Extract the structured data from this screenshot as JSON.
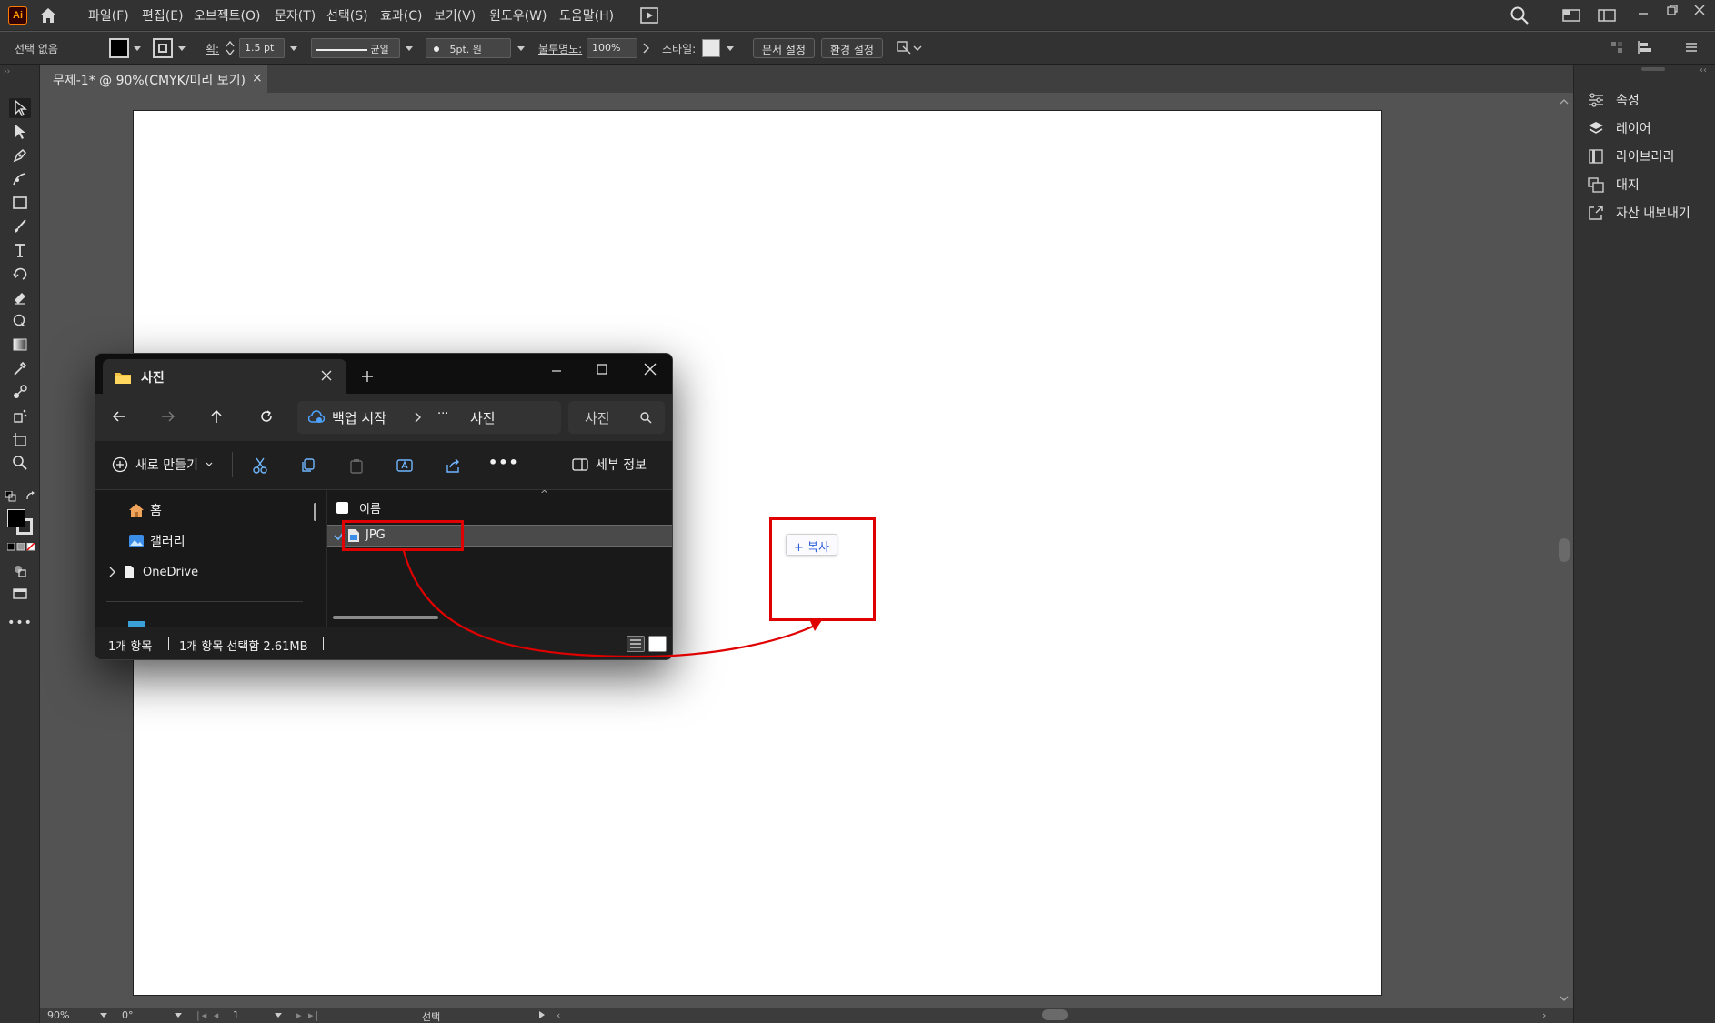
{
  "menubar": {
    "logo": "Ai",
    "items": [
      "파일(F)",
      "편집(E)",
      "오브젝트(O)",
      "문자(T)",
      "선택(S)",
      "효과(C)",
      "보기(V)",
      "윈도우(W)",
      "도움말(H)"
    ]
  },
  "controlbar": {
    "selection": "선택 없음",
    "stroke_label": "획:",
    "stroke_value": "1.5 pt",
    "profile": "균일",
    "brush": "5pt. 원",
    "opacity_label": "불투명도:",
    "opacity_value": "100%",
    "style_label": "스타일:",
    "doc_setup": "문서 설정",
    "prefs": "환경 설정"
  },
  "document_tab": {
    "title": "무제-1* @ 90%(CMYK/미리 보기)",
    "close": "×"
  },
  "right_panel": {
    "items": [
      {
        "label": "속성",
        "icon": "properties-icon"
      },
      {
        "label": "레이어",
        "icon": "layers-icon"
      },
      {
        "label": "라이브러리",
        "icon": "libraries-icon"
      },
      {
        "label": "대지",
        "icon": "artboards-icon"
      },
      {
        "label": "자산 내보내기",
        "icon": "asset-export-icon"
      }
    ]
  },
  "statusbar": {
    "zoom": "90%",
    "rotation": "0°",
    "artboard_number": "1",
    "tool_name": "선택"
  },
  "explorer": {
    "tab_title": "사진",
    "breadcrumb_root": "백업 시작",
    "breadcrumb_ellipsis": "···",
    "breadcrumb_current": "사진",
    "search_placeholder": "사진",
    "new_button": "새로 만들기",
    "details_button": "세부 정보",
    "sidebar": [
      "홈",
      "갤러리",
      "OneDrive"
    ],
    "column_name": "이름",
    "file_name": "JPG",
    "status_count": "1개 항목",
    "status_selected": "1개 항목 선택함 2.61MB"
  },
  "drop_target": {
    "tooltip": "복사"
  },
  "colors": {
    "annotation_red": "#e00000",
    "accent_orange": "#ff7c00",
    "explorer_accent": "#4da3ff"
  }
}
